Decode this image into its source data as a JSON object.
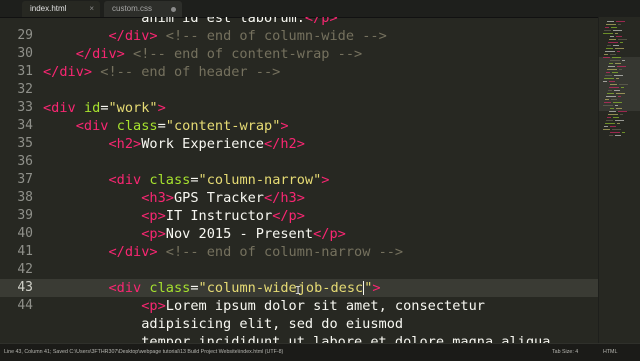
{
  "tabs": [
    {
      "label": "index.html",
      "active": true,
      "icon": "close-icon"
    },
    {
      "label": "custom.css",
      "active": false,
      "icon": "dot-icon"
    }
  ],
  "code_lines": [
    {
      "num": "",
      "partial": true,
      "tokens": [
        {
          "t": "p",
          "v": "            anim id est laborum."
        },
        {
          "t": "t",
          "v": "</p>"
        }
      ]
    },
    {
      "num": "29",
      "tokens": [
        {
          "t": "p",
          "v": "        "
        },
        {
          "t": "t",
          "v": "</div>"
        },
        {
          "t": "c",
          "v": " <!-- end of column-wide -->"
        }
      ]
    },
    {
      "num": "30",
      "tokens": [
        {
          "t": "p",
          "v": "    "
        },
        {
          "t": "t",
          "v": "</div>"
        },
        {
          "t": "c",
          "v": " <!-- end of content-wrap -->"
        }
      ]
    },
    {
      "num": "31",
      "tokens": [
        {
          "t": "t",
          "v": "</div>"
        },
        {
          "t": "c",
          "v": " <!-- end of header -->"
        }
      ]
    },
    {
      "num": "32",
      "tokens": []
    },
    {
      "num": "33",
      "tokens": [
        {
          "t": "t",
          "v": "<div"
        },
        {
          "t": "p",
          "v": " "
        },
        {
          "t": "a",
          "v": "id"
        },
        {
          "t": "p",
          "v": "="
        },
        {
          "t": "s",
          "v": "\"work\""
        },
        {
          "t": "t",
          "v": ">"
        }
      ]
    },
    {
      "num": "34",
      "tokens": [
        {
          "t": "p",
          "v": "    "
        },
        {
          "t": "t",
          "v": "<div"
        },
        {
          "t": "p",
          "v": " "
        },
        {
          "t": "a",
          "v": "class"
        },
        {
          "t": "p",
          "v": "="
        },
        {
          "t": "s",
          "v": "\"content-wrap\""
        },
        {
          "t": "t",
          "v": ">"
        }
      ]
    },
    {
      "num": "35",
      "tokens": [
        {
          "t": "p",
          "v": "        "
        },
        {
          "t": "t",
          "v": "<h2>"
        },
        {
          "t": "p",
          "v": "Work Experience"
        },
        {
          "t": "t",
          "v": "</h2>"
        }
      ]
    },
    {
      "num": "36",
      "tokens": []
    },
    {
      "num": "37",
      "tokens": [
        {
          "t": "p",
          "v": "        "
        },
        {
          "t": "t",
          "v": "<div"
        },
        {
          "t": "p",
          "v": " "
        },
        {
          "t": "a",
          "v": "class"
        },
        {
          "t": "p",
          "v": "="
        },
        {
          "t": "s",
          "v": "\"column-narrow\""
        },
        {
          "t": "t",
          "v": ">"
        }
      ]
    },
    {
      "num": "38",
      "tokens": [
        {
          "t": "p",
          "v": "            "
        },
        {
          "t": "t",
          "v": "<h3>"
        },
        {
          "t": "p",
          "v": "GPS Tracker"
        },
        {
          "t": "t",
          "v": "</h3>"
        }
      ]
    },
    {
      "num": "39",
      "tokens": [
        {
          "t": "p",
          "v": "            "
        },
        {
          "t": "t",
          "v": "<p>"
        },
        {
          "t": "p",
          "v": "IT Instructor"
        },
        {
          "t": "t",
          "v": "</p>"
        }
      ]
    },
    {
      "num": "40",
      "tokens": [
        {
          "t": "p",
          "v": "            "
        },
        {
          "t": "t",
          "v": "<p>"
        },
        {
          "t": "p",
          "v": "Nov 2015 - Present"
        },
        {
          "t": "t",
          "v": "</p>"
        }
      ]
    },
    {
      "num": "41",
      "tokens": [
        {
          "t": "p",
          "v": "        "
        },
        {
          "t": "t",
          "v": "</div>"
        },
        {
          "t": "c",
          "v": " <!-- end of column-narrow -->"
        }
      ]
    },
    {
      "num": "42",
      "tokens": []
    },
    {
      "num": "43",
      "current": true,
      "tokens": [
        {
          "t": "p",
          "v": "        "
        },
        {
          "t": "t",
          "v": "<div"
        },
        {
          "t": "p",
          "v": " "
        },
        {
          "t": "a",
          "v": "class"
        },
        {
          "t": "p",
          "v": "="
        },
        {
          "t": "s",
          "v": "\"column-wide"
        },
        {
          "t": "ibeam",
          "v": "I"
        },
        {
          "t": "s",
          "v": "job-desc"
        },
        {
          "t": "cursor",
          "v": ""
        },
        {
          "t": "s",
          "v": "\""
        },
        {
          "t": "t",
          "v": ">"
        }
      ]
    },
    {
      "num": "44",
      "tokens": [
        {
          "t": "p",
          "v": "            "
        },
        {
          "t": "t",
          "v": "<p>"
        },
        {
          "t": "p",
          "v": "Lorem ipsum dolor sit amet, consectetur"
        }
      ]
    },
    {
      "num": "",
      "tokens": [
        {
          "t": "p",
          "v": "            adipisicing elit, sed do eiusmod"
        }
      ]
    },
    {
      "num": "",
      "partial": true,
      "tokens": [
        {
          "t": "p",
          "v": "            tempor incididunt ut labore et dolore magna aliqua"
        }
      ]
    }
  ],
  "status": {
    "left": "Line 43, Column 41; Saved C:\\Users\\3FTHR307\\Desktop\\webpage tutorial\\13 Build Project Website\\index.html (UTF-8)",
    "tab_size": "Tab Size: 4",
    "syntax": "HTML"
  },
  "colors": {
    "background": "#272822",
    "tag": "#f92672",
    "attribute": "#a6e22e",
    "string": "#e6db74",
    "comment": "#75715e",
    "text": "#f8f8f2"
  }
}
